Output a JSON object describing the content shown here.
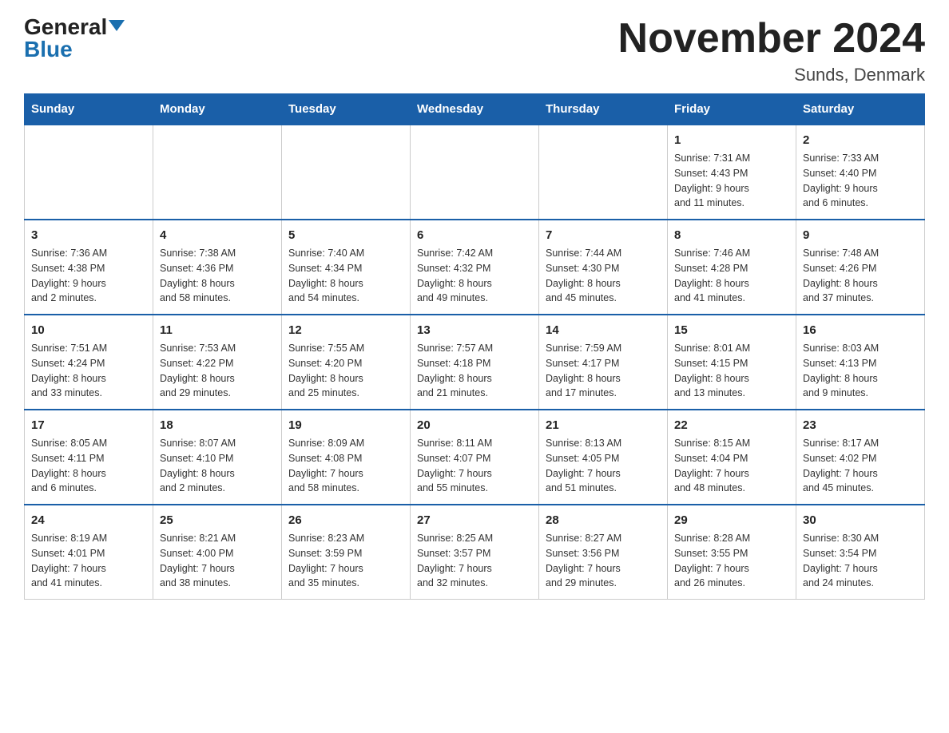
{
  "logo": {
    "general": "General",
    "blue": "Blue"
  },
  "title": "November 2024",
  "subtitle": "Sunds, Denmark",
  "days_of_week": [
    "Sunday",
    "Monday",
    "Tuesday",
    "Wednesday",
    "Thursday",
    "Friday",
    "Saturday"
  ],
  "weeks": [
    [
      {
        "day": "",
        "info": ""
      },
      {
        "day": "",
        "info": ""
      },
      {
        "day": "",
        "info": ""
      },
      {
        "day": "",
        "info": ""
      },
      {
        "day": "",
        "info": ""
      },
      {
        "day": "1",
        "info": "Sunrise: 7:31 AM\nSunset: 4:43 PM\nDaylight: 9 hours\nand 11 minutes."
      },
      {
        "day": "2",
        "info": "Sunrise: 7:33 AM\nSunset: 4:40 PM\nDaylight: 9 hours\nand 6 minutes."
      }
    ],
    [
      {
        "day": "3",
        "info": "Sunrise: 7:36 AM\nSunset: 4:38 PM\nDaylight: 9 hours\nand 2 minutes."
      },
      {
        "day": "4",
        "info": "Sunrise: 7:38 AM\nSunset: 4:36 PM\nDaylight: 8 hours\nand 58 minutes."
      },
      {
        "day": "5",
        "info": "Sunrise: 7:40 AM\nSunset: 4:34 PM\nDaylight: 8 hours\nand 54 minutes."
      },
      {
        "day": "6",
        "info": "Sunrise: 7:42 AM\nSunset: 4:32 PM\nDaylight: 8 hours\nand 49 minutes."
      },
      {
        "day": "7",
        "info": "Sunrise: 7:44 AM\nSunset: 4:30 PM\nDaylight: 8 hours\nand 45 minutes."
      },
      {
        "day": "8",
        "info": "Sunrise: 7:46 AM\nSunset: 4:28 PM\nDaylight: 8 hours\nand 41 minutes."
      },
      {
        "day": "9",
        "info": "Sunrise: 7:48 AM\nSunset: 4:26 PM\nDaylight: 8 hours\nand 37 minutes."
      }
    ],
    [
      {
        "day": "10",
        "info": "Sunrise: 7:51 AM\nSunset: 4:24 PM\nDaylight: 8 hours\nand 33 minutes."
      },
      {
        "day": "11",
        "info": "Sunrise: 7:53 AM\nSunset: 4:22 PM\nDaylight: 8 hours\nand 29 minutes."
      },
      {
        "day": "12",
        "info": "Sunrise: 7:55 AM\nSunset: 4:20 PM\nDaylight: 8 hours\nand 25 minutes."
      },
      {
        "day": "13",
        "info": "Sunrise: 7:57 AM\nSunset: 4:18 PM\nDaylight: 8 hours\nand 21 minutes."
      },
      {
        "day": "14",
        "info": "Sunrise: 7:59 AM\nSunset: 4:17 PM\nDaylight: 8 hours\nand 17 minutes."
      },
      {
        "day": "15",
        "info": "Sunrise: 8:01 AM\nSunset: 4:15 PM\nDaylight: 8 hours\nand 13 minutes."
      },
      {
        "day": "16",
        "info": "Sunrise: 8:03 AM\nSunset: 4:13 PM\nDaylight: 8 hours\nand 9 minutes."
      }
    ],
    [
      {
        "day": "17",
        "info": "Sunrise: 8:05 AM\nSunset: 4:11 PM\nDaylight: 8 hours\nand 6 minutes."
      },
      {
        "day": "18",
        "info": "Sunrise: 8:07 AM\nSunset: 4:10 PM\nDaylight: 8 hours\nand 2 minutes."
      },
      {
        "day": "19",
        "info": "Sunrise: 8:09 AM\nSunset: 4:08 PM\nDaylight: 7 hours\nand 58 minutes."
      },
      {
        "day": "20",
        "info": "Sunrise: 8:11 AM\nSunset: 4:07 PM\nDaylight: 7 hours\nand 55 minutes."
      },
      {
        "day": "21",
        "info": "Sunrise: 8:13 AM\nSunset: 4:05 PM\nDaylight: 7 hours\nand 51 minutes."
      },
      {
        "day": "22",
        "info": "Sunrise: 8:15 AM\nSunset: 4:04 PM\nDaylight: 7 hours\nand 48 minutes."
      },
      {
        "day": "23",
        "info": "Sunrise: 8:17 AM\nSunset: 4:02 PM\nDaylight: 7 hours\nand 45 minutes."
      }
    ],
    [
      {
        "day": "24",
        "info": "Sunrise: 8:19 AM\nSunset: 4:01 PM\nDaylight: 7 hours\nand 41 minutes."
      },
      {
        "day": "25",
        "info": "Sunrise: 8:21 AM\nSunset: 4:00 PM\nDaylight: 7 hours\nand 38 minutes."
      },
      {
        "day": "26",
        "info": "Sunrise: 8:23 AM\nSunset: 3:59 PM\nDaylight: 7 hours\nand 35 minutes."
      },
      {
        "day": "27",
        "info": "Sunrise: 8:25 AM\nSunset: 3:57 PM\nDaylight: 7 hours\nand 32 minutes."
      },
      {
        "day": "28",
        "info": "Sunrise: 8:27 AM\nSunset: 3:56 PM\nDaylight: 7 hours\nand 29 minutes."
      },
      {
        "day": "29",
        "info": "Sunrise: 8:28 AM\nSunset: 3:55 PM\nDaylight: 7 hours\nand 26 minutes."
      },
      {
        "day": "30",
        "info": "Sunrise: 8:30 AM\nSunset: 3:54 PM\nDaylight: 7 hours\nand 24 minutes."
      }
    ]
  ]
}
